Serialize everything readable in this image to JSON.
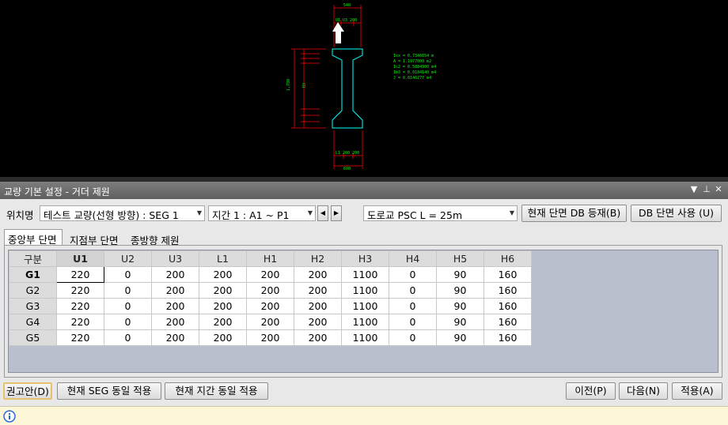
{
  "cad": {
    "dim_top": "540",
    "top_labels": "U1  U3  200",
    "dim_height": "1,780",
    "web_label": "H3",
    "bottom_labels": "L1  200  200",
    "dim_bottom": "600",
    "props": [
      "Ixx = 0.7346654 m",
      "A   = 1.1977000 m2",
      "Ic2 = 0.5884900 m4",
      "Ib3 = 0.0184140 m4",
      "J   = 0.0146277 m4"
    ],
    "colors": {
      "dim": "#ff0000",
      "section": "#00ffff",
      "text": "#00ff00",
      "arrow": "#ffffff"
    }
  },
  "panel": {
    "title": "교량 기본 설정 - 거더 제원",
    "pin_icon": "pin-icon",
    "menu_icon": "dropdown-icon",
    "close_icon": "close-icon"
  },
  "toolbar": {
    "position_label": "위치명",
    "bridge_select": "테스트 교량(선형 방향) : SEG 1",
    "span_select": "지간 1 : A1 ~ P1",
    "prev_icon": "triangle-left-icon",
    "next_icon": "triangle-right-icon",
    "girder_select": "도로교 PSC L = 25m",
    "register_button": "현재 단면 DB 등재(B)",
    "use_db_button": "DB 단면 사용 (U)"
  },
  "tabs": [
    "중앙부 단면",
    "지점부 단면",
    "종방향 제원"
  ],
  "grid": {
    "columns": [
      "구분",
      "U1",
      "U2",
      "U3",
      "L1",
      "H1",
      "H2",
      "H3",
      "H4",
      "H5",
      "H6"
    ],
    "rows": [
      {
        "label": "G1",
        "values": [
          "220",
          "0",
          "200",
          "200",
          "200",
          "200",
          "1100",
          "0",
          "90",
          "160"
        ]
      },
      {
        "label": "G2",
        "values": [
          "220",
          "0",
          "200",
          "200",
          "200",
          "200",
          "1100",
          "0",
          "90",
          "160"
        ]
      },
      {
        "label": "G3",
        "values": [
          "220",
          "0",
          "200",
          "200",
          "200",
          "200",
          "1100",
          "0",
          "90",
          "160"
        ]
      },
      {
        "label": "G4",
        "values": [
          "220",
          "0",
          "200",
          "200",
          "200",
          "200",
          "1100",
          "0",
          "90",
          "160"
        ]
      },
      {
        "label": "G5",
        "values": [
          "220",
          "0",
          "200",
          "200",
          "200",
          "200",
          "1100",
          "0",
          "90",
          "160"
        ]
      }
    ]
  },
  "bottom": {
    "recommend_button": "권고안(D)",
    "apply_seg_button": "현재 SEG 동일 적용",
    "apply_span_button": "현재 지간 동일 적용",
    "prev_button": "이전(P)",
    "next_button": "다음(N)",
    "apply_button": "적용(A)"
  },
  "status": {
    "icon": "info-icon"
  }
}
